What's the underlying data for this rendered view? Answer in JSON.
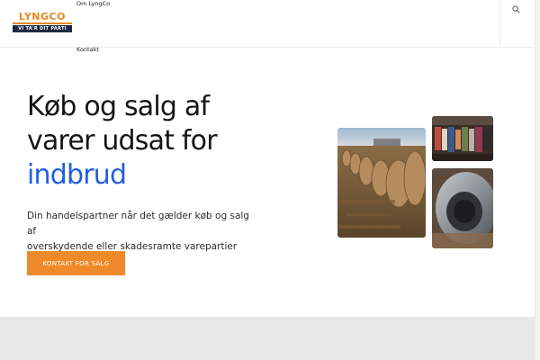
{
  "logo": {
    "wordmark": "LYNGCO",
    "tagline": "VI TA'R DIT PARTI"
  },
  "nav": {
    "items": [
      {
        "label": "Om LyngCo"
      },
      {
        "label": "Kontakt"
      }
    ]
  },
  "search": {
    "icon": "search-icon"
  },
  "hero": {
    "title_lines": [
      "Køb og salg af",
      "varer udsat for"
    ],
    "title_accent": "indbrud",
    "subtitle_lines": [
      "Din handelspartner når det gælder køb og salg af",
      "overskydende eller skadesramte varepartier"
    ],
    "cta_label": "KONTAKT FOR SALG"
  },
  "colors": {
    "accent_blue": "#1f5fe0",
    "cta_orange": "#f0892a",
    "logo_orange": "#e8881e",
    "logo_navy": "#1c2a44"
  }
}
